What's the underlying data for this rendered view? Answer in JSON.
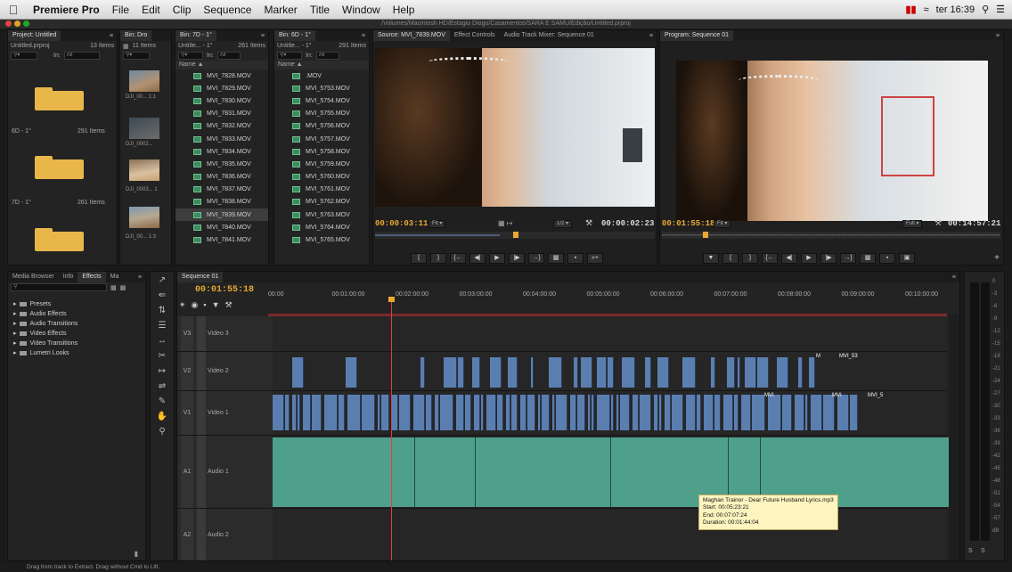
{
  "menubar": {
    "apple": "",
    "app_name": "Premiere Pro",
    "items": [
      "File",
      "Edit",
      "Clip",
      "Sequence",
      "Marker",
      "Title",
      "Window",
      "Help"
    ],
    "status_time": "ter 16:39"
  },
  "window": {
    "path": "/Volumes/Macintosh HD/Estagio Diogo/Casamentos/SARA E SAMU/Edição/Untitled.prproj"
  },
  "project_panel": {
    "tab": "Project: Untitled",
    "file": "Untitled.prproj",
    "count": "13 Items",
    "in_label": "In:",
    "in_value": "All",
    "bins": [
      {
        "name": "6D - 1°",
        "count": "291 Items"
      },
      {
        "name": "7D - 1°",
        "count": "261 Items"
      }
    ]
  },
  "bin_din": {
    "tab": "Bin: Dro",
    "count": "11 Items",
    "thumbs": [
      "DJI_00... 1:1",
      "DJI_0002...",
      "DJI_0003... 1",
      "DJI_00... 1:3"
    ]
  },
  "bin_7d": {
    "tab": "Bin: 7D - 1°",
    "title": "Untitle... - 1°",
    "count": "261 Items",
    "in_label": "In:",
    "in_value": "All",
    "name_header": "Name",
    "files": [
      "MVI_7828.MOV",
      "MVI_7829.MOV",
      "MVI_7830.MOV",
      "MVI_7831.MOV",
      "MVI_7832.MOV",
      "MVI_7833.MOV",
      "MVI_7834.MOV",
      "MVI_7835.MOV",
      "MVI_7836.MOV",
      "MVI_7837.MOV",
      "MVI_7838.MOV",
      "MVI_7839.MOV",
      "MVI_7840.MOV",
      "MVI_7841.MOV"
    ],
    "selected_index": 11
  },
  "bin_6d": {
    "tab": "Bin: 6D - 1°",
    "title": "Untitle... - 1°",
    "count": "291 Items",
    "in_label": "In:",
    "in_value": "All",
    "name_header": "Name",
    "files": [
      ".MOV",
      "MVI_5753.MOV",
      "MVI_5754.MOV",
      "MVI_5755.MOV",
      "MVI_5756.MOV",
      "MVI_5757.MOV",
      "MVI_5758.MOV",
      "MVI_5759.MOV",
      "MVI_5760.MOV",
      "MVI_5761.MOV",
      "MVI_5762.MOV",
      "MVI_5763.MOV",
      "MVI_5764.MOV",
      "MVI_5765.MOV"
    ]
  },
  "source_monitor": {
    "tabs": [
      "Source: MVI_7839.MOV",
      "Effect Controls",
      "Audio Track Mixer: Sequence 01"
    ],
    "timecode": "00:00:03:11",
    "fit": "Fit",
    "resolution": "1/2",
    "duration": "00:00:02:23"
  },
  "program_monitor": {
    "tab": "Program: Sequence 01",
    "timecode": "00:01:55:18",
    "fit": "Fit",
    "resolution": "Full",
    "duration": "00:14:57:21"
  },
  "effects_panel": {
    "tabs": [
      "Media Browser",
      "Info",
      "Effects",
      "Ma"
    ],
    "search_placeholder": "",
    "tree": [
      "Presets",
      "Audio Effects",
      "Audio Transitions",
      "Video Effects",
      "Video Transitions",
      "Lumetri Looks"
    ]
  },
  "timeline": {
    "tab": "Sequence 01",
    "timecode": "00:01:55:18",
    "ruler": [
      "00:00",
      "00:01:00:00",
      "00:02:00:00",
      "00:03:00:00",
      "00:04:00:00",
      "00:05:00:00",
      "00:06:00:00",
      "00:07:00:00",
      "00:08:00:00",
      "00:09:00:00",
      "00:10:00:00"
    ],
    "tracks": [
      {
        "id": "V3",
        "name": "Video 3"
      },
      {
        "id": "V2",
        "name": "Video 2"
      },
      {
        "id": "V1",
        "name": "Video 1"
      },
      {
        "id": "A1",
        "name": "Audio 1"
      },
      {
        "id": "A2",
        "name": "Audio 2"
      }
    ],
    "clip_labels": [
      "M",
      "MVI_53",
      "MVI",
      "MVI",
      "MVI_5"
    ],
    "tooltip": {
      "title": "Maghan Trainor - Dear Future Husband Lyrics.mp3",
      "start": "Start: 00:05:23:21",
      "end": "End: 00:07:07:24",
      "duration": "Duration: 00:01:44:04"
    }
  },
  "meter": {
    "labels": [
      "0",
      "-3",
      "-6",
      "-9",
      "-12",
      "-15",
      "-18",
      "-21",
      "-24",
      "-27",
      "-30",
      "-33",
      "-36",
      "-39",
      "-42",
      "-45",
      "-48",
      "-51",
      "-54",
      "-57",
      "dB"
    ],
    "solo": "S",
    "s2": "S"
  },
  "status": {
    "text": "Drag from track to Extract. Drag without Cmd to Lift."
  }
}
